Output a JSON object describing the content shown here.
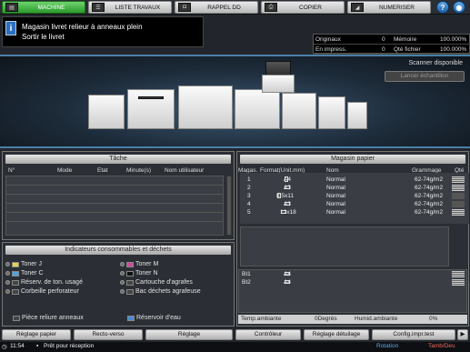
{
  "tabs": {
    "machine": "MACHINE",
    "jobs": "LISTE TRAVAUX",
    "recall": "RAPPEL DD",
    "copy": "COPIER",
    "scan": "NUMERISER"
  },
  "icons": {
    "machine": "printer-icon",
    "jobs": "list-icon",
    "recall": "disk-icon",
    "copy": "copier-icon",
    "scan": "scanner-icon",
    "help": "help-icon",
    "settings": "settings-icon"
  },
  "message": {
    "icon": "i",
    "line1": "Magasin livret relieur à anneaux plein",
    "line2": "Sortir le livret"
  },
  "counters": {
    "originals_label": "Originaux",
    "originals_value": "0",
    "memory_label": "Mémoire",
    "memory_value": "100.000%",
    "printing_label": "En impress.",
    "printing_value": "0",
    "hdd_label": "Qté fichier",
    "hdd_value": "100.000%"
  },
  "machine": {
    "scanner_status": "Scanner disponible",
    "sample_button": "Lancer échantillon"
  },
  "jobs_panel": {
    "title": "Tâche",
    "columns": [
      "N°",
      "Mode",
      "Etat",
      "Minute(s)",
      "Nom utilisateur"
    ]
  },
  "consumables": {
    "title": "Indicateurs consommables et déchets",
    "left": [
      "Toner J",
      "Toner C",
      "Réserv. de ton. usagé",
      "Corbeille perforateur"
    ],
    "right": [
      "Toner M",
      "Toner N",
      "Cartouche d'agrafes",
      "Bac déchets agrafeuse"
    ],
    "bottom_left": "Pièce reliure anneaux",
    "bottom_right": "Réservoir d'eau"
  },
  "paper": {
    "title": "Magasin papier",
    "columns": [
      "Magas.",
      "Format(Unit.mm)",
      "Nom",
      "Grammage",
      "Qté"
    ],
    "trays": [
      {
        "tray": "1",
        "size": "A4",
        "name": "Normal",
        "weight": "62-74g/m2"
      },
      {
        "tray": "2",
        "size": "A3",
        "name": "Normal",
        "weight": "62-74g/m2"
      },
      {
        "tray": "3",
        "size": "8.5x11",
        "name": "Normal",
        "weight": "62-74g/m2"
      },
      {
        "tray": "4",
        "size": "A3",
        "name": "Normal",
        "weight": "62-74g/m2"
      },
      {
        "tray": "5",
        "size": "12x18",
        "name": "Normal",
        "weight": "62-74g/m2"
      }
    ],
    "inserters": [
      {
        "tray": "BI1",
        "size": "A4"
      },
      {
        "tray": "BI2",
        "size": "A4"
      }
    ],
    "temp_label": "Temp.ambiante",
    "temp_value": "0Degrés",
    "hum_label": "Humid.ambiante",
    "hum_value": "0%"
  },
  "bottom_buttons": [
    "Réglage papier",
    "Recto-verso",
    "Réglage",
    "Contrôleur",
    "Réglage détuilage",
    "Config.impr.test"
  ],
  "status": {
    "time": "11:54",
    "message": "Prêt pour réception",
    "rotation": "Rotation",
    "tamb": "Tamb/Dev."
  }
}
